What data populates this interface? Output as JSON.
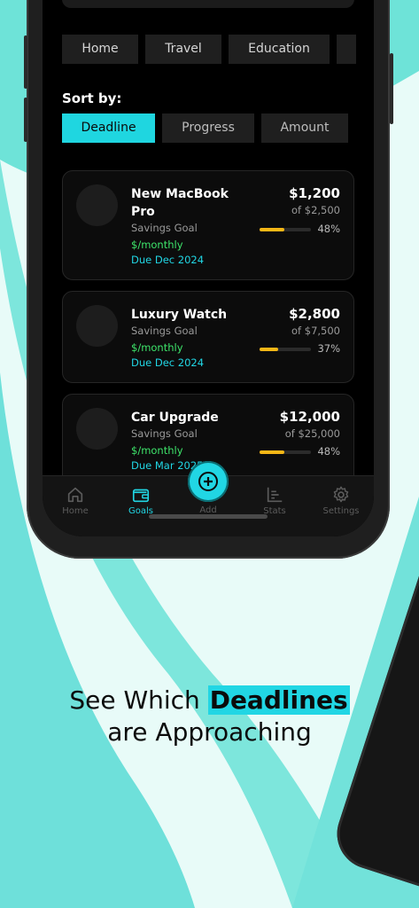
{
  "categories": [
    "Home",
    "Travel",
    "Education"
  ],
  "sort": {
    "label": "Sort by:",
    "options": [
      "Deadline",
      "Progress",
      "Amount"
    ],
    "active": "Deadline"
  },
  "goals": [
    {
      "title": "New MacBook Pro",
      "type": "Savings Goal",
      "frequency": "$/monthly",
      "due": "Due Dec 2024",
      "amount": "$1,200",
      "target": "of $2,500",
      "percent": "48%",
      "progress": 0.48
    },
    {
      "title": "Luxury Watch",
      "type": "Savings Goal",
      "frequency": "$/monthly",
      "due": "Due Dec 2024",
      "amount": "$2,800",
      "target": "of $7,500",
      "percent": "37%",
      "progress": 0.37
    },
    {
      "title": "Car Upgrade",
      "type": "Savings Goal",
      "frequency": "$/monthly",
      "due": "Due Mar 2025",
      "amount": "$12,000",
      "target": "of $25,000",
      "percent": "48%",
      "progress": 0.48
    }
  ],
  "tabs": {
    "home": "Home",
    "goals": "Goals",
    "add": "Add",
    "stats": "Stats",
    "settings": "Settings"
  },
  "headline": {
    "before": "See Which",
    "highlight": "Deadlines",
    "after": "are Approaching"
  },
  "colors": {
    "accent": "#21d6e4",
    "progress": "#f6b716",
    "frequency": "#3ee56b",
    "background_light": "#e6fbf8",
    "background_wave": "#5fe0d6"
  }
}
